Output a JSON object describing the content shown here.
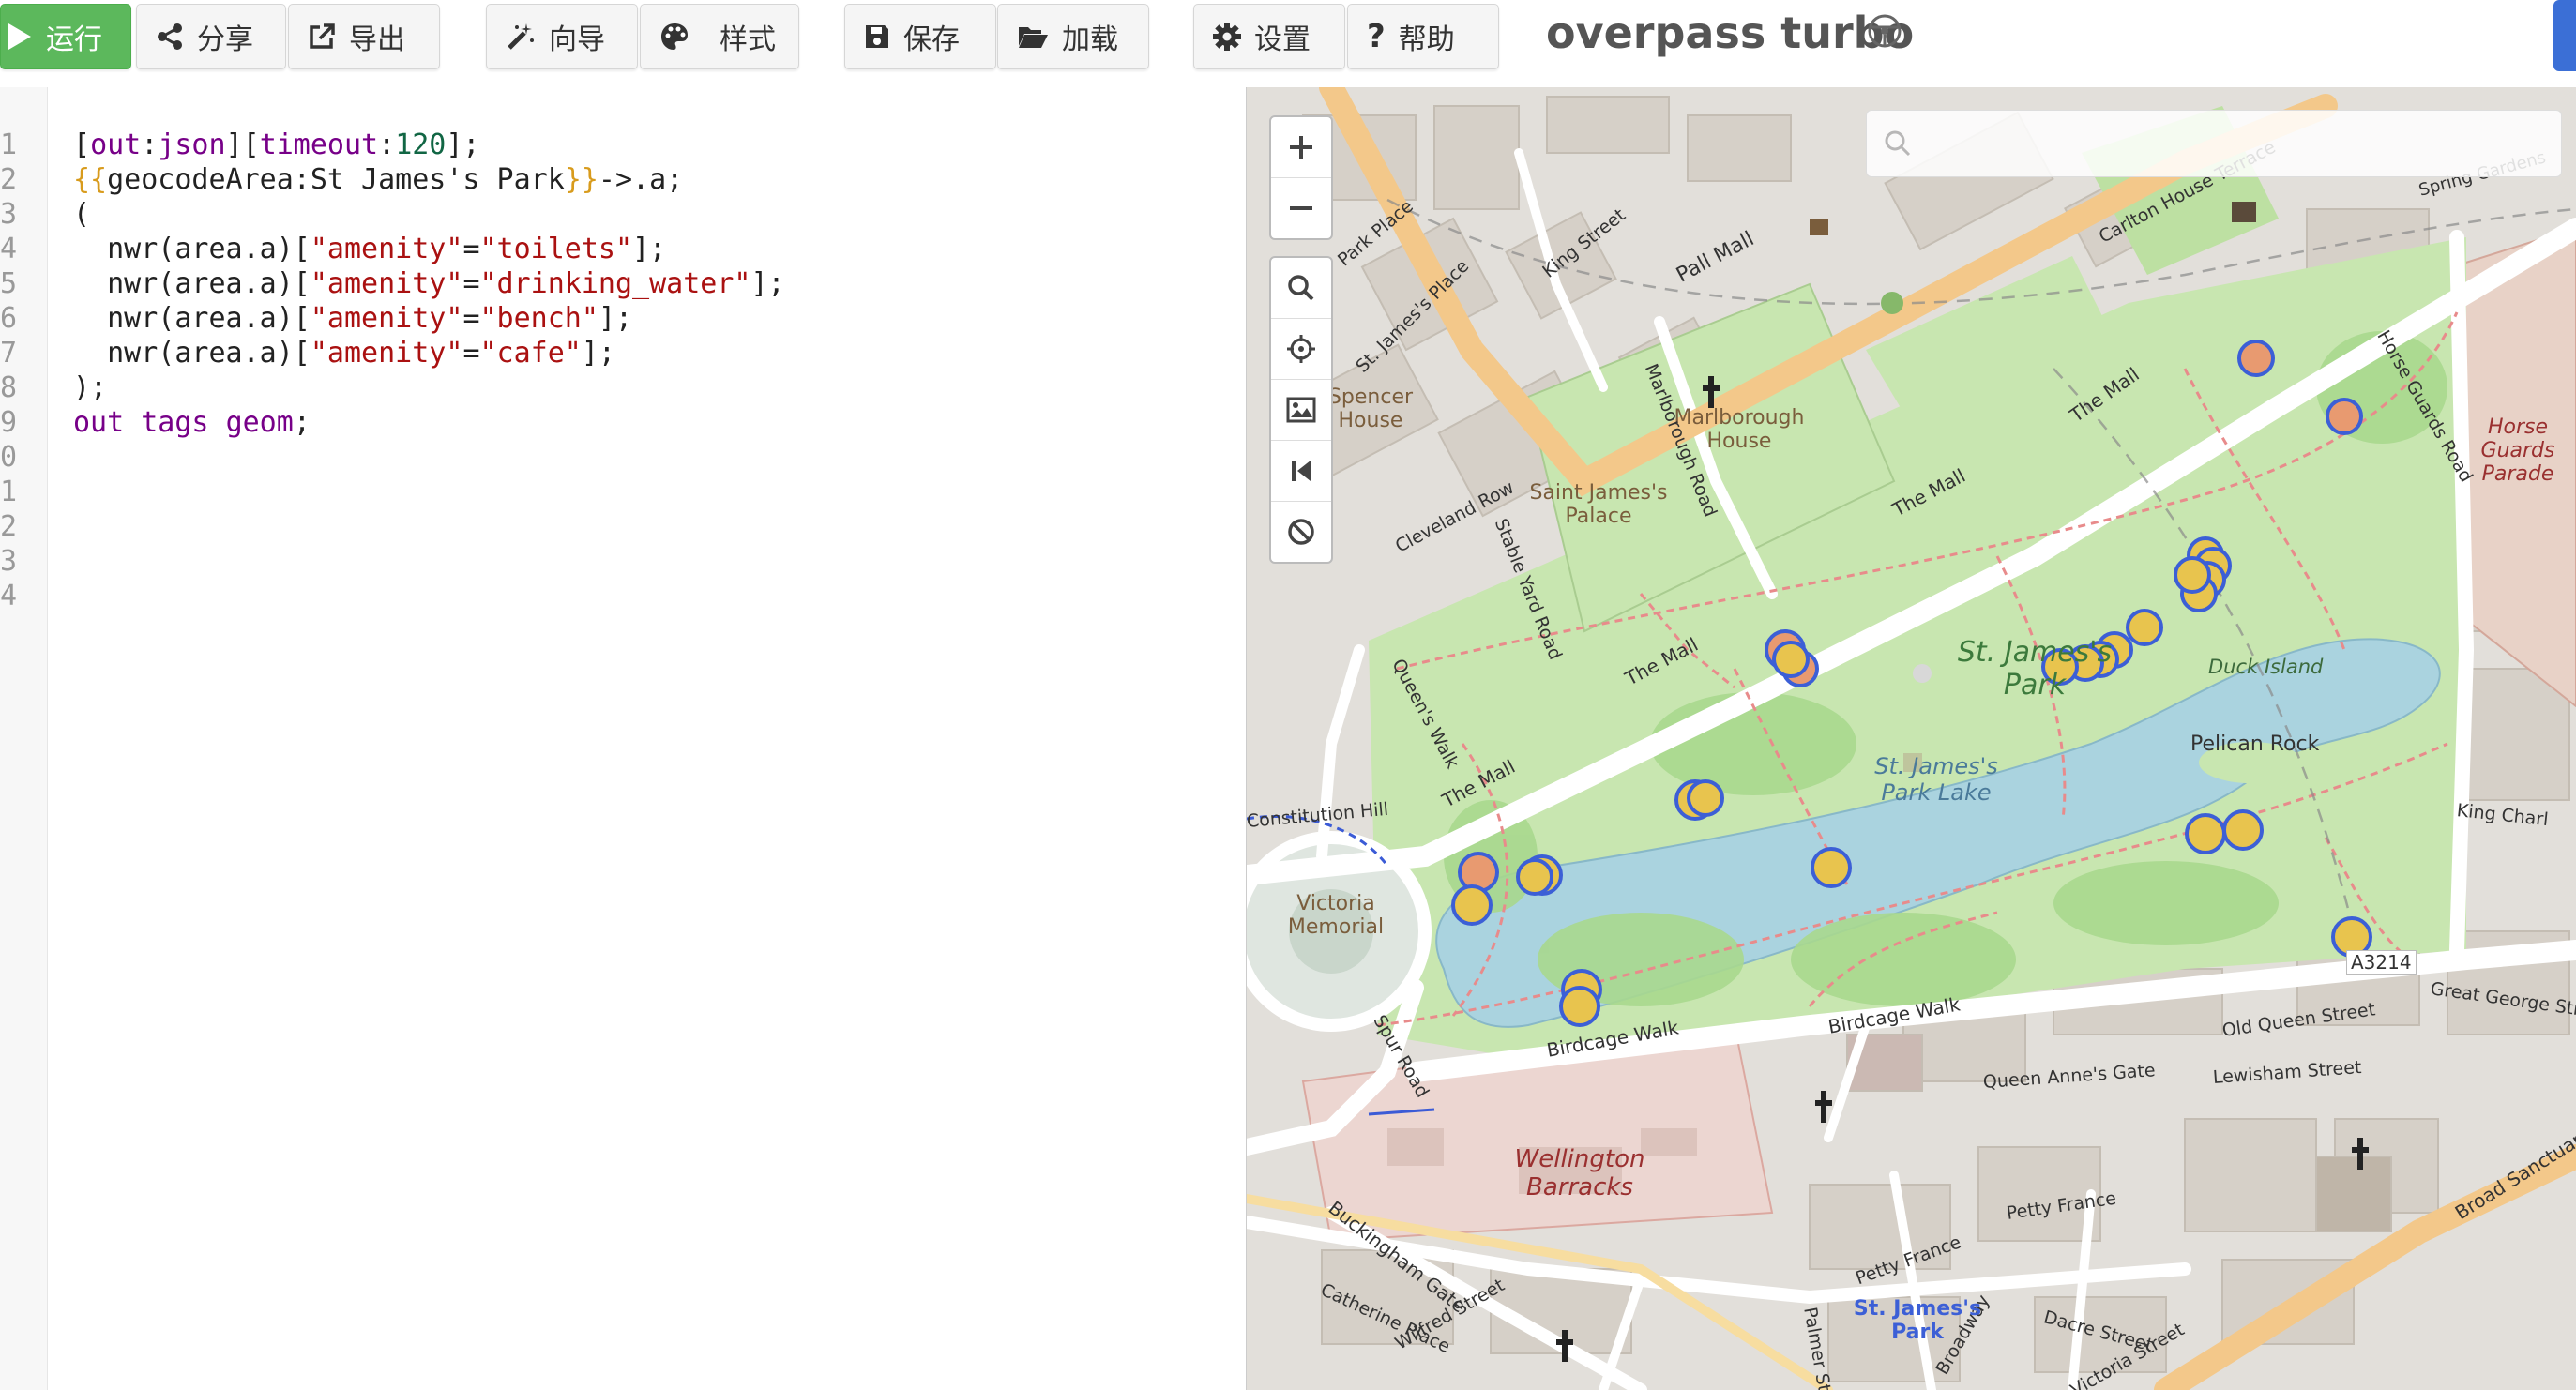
{
  "toolbar": {
    "run": "运行",
    "share": "分享",
    "export": "导出",
    "wizard": "向导",
    "style": "样式",
    "save": "保存",
    "load": "加载",
    "settings": "设置",
    "help": "帮助",
    "title": "overpass turbo"
  },
  "editor": {
    "line_numbers": [
      "1",
      "2",
      "3",
      "4",
      "5",
      "6",
      "7",
      "8",
      "9",
      "0",
      "1",
      "2",
      "3",
      "4"
    ],
    "code_lines": [
      "[out:json][timeout:120];",
      "{{geocodeArea:St James's Park}}->.a;",
      "(",
      "  nwr(area.a)[\"amenity\"=\"toilets\"];",
      "  nwr(area.a)[\"amenity\"=\"drinking_water\"];",
      "  nwr(area.a)[\"amenity\"=\"bench\"];",
      "  nwr(area.a)[\"amenity\"=\"cafe\"];",
      ");",
      "out tags geom;"
    ]
  },
  "map": {
    "labels": {
      "spencer_house": "Spencer House",
      "marlborough_house": "Marlborough House",
      "saint_jamess_palace": "Saint James's Palace",
      "st_james_park": "St. James's Park",
      "lake": "St. James's Park Lake",
      "duck_island": "Duck Island",
      "pelican_rock": "Pelican Rock",
      "victoria_memorial": "Victoria Memorial",
      "wellington_barracks": "Wellington Barracks",
      "horse_guards_parade": "Horse Guards Parade",
      "the_mall": "The Mall",
      "pall_mall": "Pall Mall",
      "birdcage_walk": "Birdcage Walk",
      "constitution_hill": "Constitution Hill",
      "spur_road": "Spur Road",
      "queens_walk": "Queen's Walk",
      "marlborough_road": "Marlborough Road",
      "stable_yard_road": "Stable Yard Road",
      "cleveland_row": "Cleveland Row",
      "king_street": "King Street",
      "park_place": "Park Place",
      "st_jamess_place": "St. James's Place",
      "carlton_house_terrace": "Carlton House Terrace",
      "horse_guards_road": "Horse Guards Road",
      "old_queen_street": "Old Queen Street",
      "queen_annes_gate": "Queen Anne's Gate",
      "lewisham_street": "Lewisham Street",
      "great_george_street": "Great George Str",
      "petty_france": "Petty France",
      "buckingham_gate": "Buckingham Gate",
      "catherine_place": "Catherine Place",
      "wilfred_street": "Wilfred Street",
      "palmer_street": "Palmer Street",
      "dacre_street": "Dacre Street",
      "broadway": "Broadway",
      "victoria_street": "Victoria Street",
      "st_jamess_park_station": "St. James's Park",
      "broad_sanctuary": "Broad Sanctuary",
      "king_charles": "King Charl",
      "spring_gardens": "Spring Gardens",
      "a3214": "A3214"
    },
    "colors": {
      "marker_fill": "#e8c44e",
      "marker_fill_alt": "#e89a70",
      "marker_stroke": "#3c5fd6",
      "park": "#c8e6b0",
      "water": "#aad3df",
      "road_orange": "#f3c88a"
    }
  }
}
